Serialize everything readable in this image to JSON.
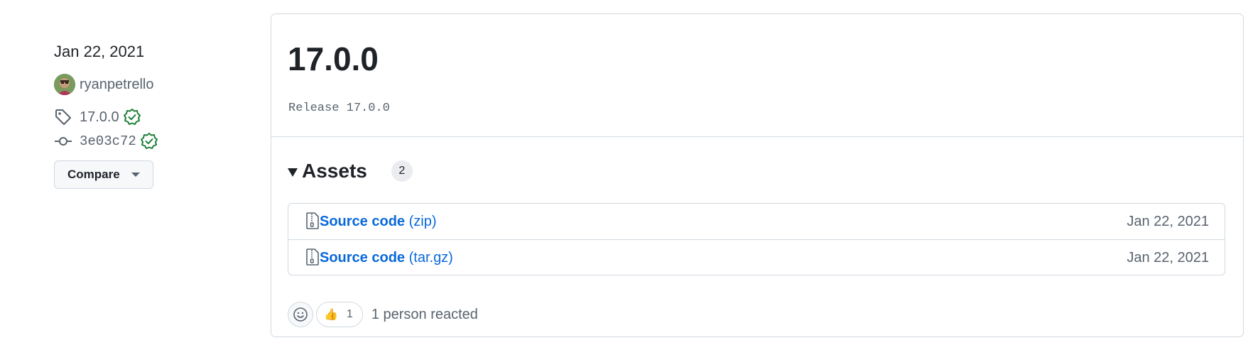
{
  "sidebar": {
    "date": "Jan 22, 2021",
    "author": "ryanpetrello",
    "tag": "17.0.0",
    "commit": "3e03c72",
    "compare_label": "Compare"
  },
  "release": {
    "title": "17.0.0",
    "body": "Release 17.0.0"
  },
  "assets": {
    "title": "Assets",
    "count": "2",
    "items": [
      {
        "name": "Source code",
        "ext": "(zip)",
        "date": "Jan 22, 2021"
      },
      {
        "name": "Source code",
        "ext": "(tar.gz)",
        "date": "Jan 22, 2021"
      }
    ]
  },
  "reactions": {
    "thumbs_emoji": "👍",
    "thumbs_count": "1",
    "summary": "1 person reacted"
  },
  "colors": {
    "link": "#0969da",
    "verified": "#1a7f37",
    "border": "#d1d9e0",
    "muted": "#59636e"
  }
}
